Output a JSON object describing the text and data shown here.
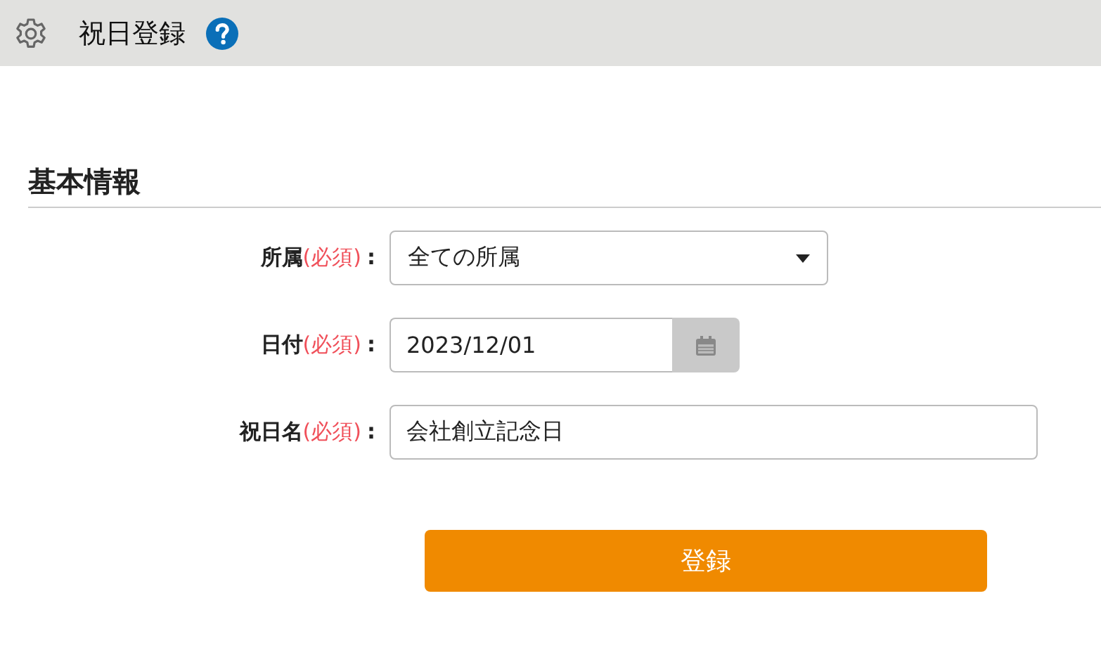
{
  "header": {
    "title": "祝日登録"
  },
  "section": {
    "title": "基本情報"
  },
  "fields": [
    {
      "kind": "select",
      "label": "所属",
      "required": "(必須)",
      "colon": ":",
      "value": "全ての所属"
    },
    {
      "kind": "date",
      "label": "日付",
      "required": "(必須)",
      "colon": ":",
      "value": "2023/12/01"
    },
    {
      "kind": "text",
      "label": "祝日名",
      "required": "(必須)",
      "colon": ":",
      "value": "会社創立記念日"
    }
  ],
  "submit": {
    "label": "登録"
  }
}
